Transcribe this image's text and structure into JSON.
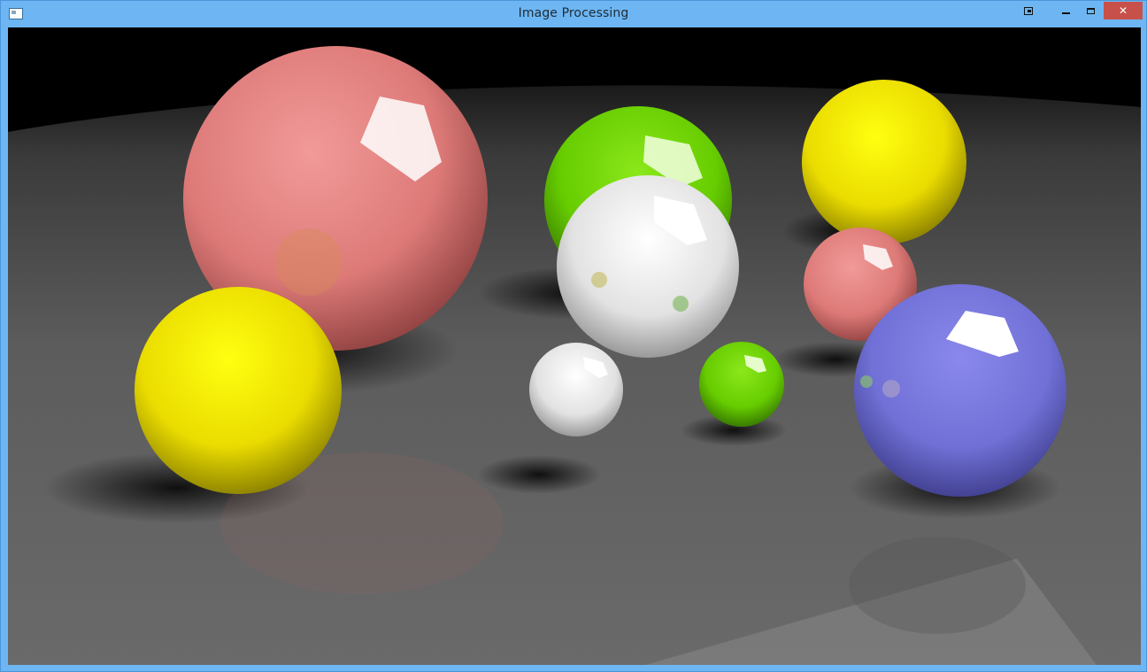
{
  "window": {
    "title": "Image Processing",
    "icons": {
      "system_menu": "app-icon",
      "extra": "pin-icon",
      "minimize": "minimize-icon",
      "maximize": "maximize-icon",
      "close": "close-icon"
    },
    "close_symbol": "✕"
  },
  "colors": {
    "frame": "#6db6f3",
    "close": "#c7514a",
    "floor": "#5a5a5a",
    "sphere_pink": "#e37d7b",
    "sphere_yellow": "#f2e200",
    "sphere_green": "#6ad000",
    "sphere_white": "#e8e8e8",
    "sphere_blue": "#7472d8"
  },
  "scene": {
    "description_type": "rendered-image",
    "spheres": [
      "pink",
      "green",
      "yellow",
      "white",
      "pink",
      "yellow",
      "white",
      "green",
      "blue"
    ]
  }
}
